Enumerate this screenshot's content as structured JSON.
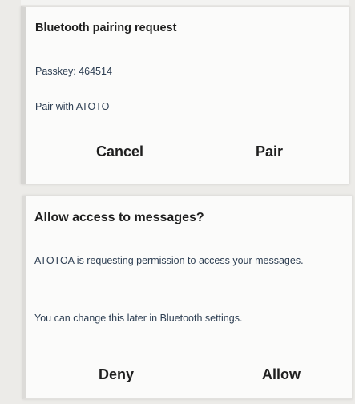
{
  "pairing_dialog": {
    "title": "Bluetooth pairing request",
    "passkey": "Passkey: 464514",
    "pair_with": "Pair with ATOTO",
    "cancel_label": "Cancel",
    "pair_label": "Pair"
  },
  "messages_dialog": {
    "title": "Allow access to messages?",
    "body": "ATOTOA is requesting permission to access your messages.",
    "note": "You can change this later in Bluetooth settings.",
    "deny_label": "Deny",
    "allow_label": "Allow"
  }
}
